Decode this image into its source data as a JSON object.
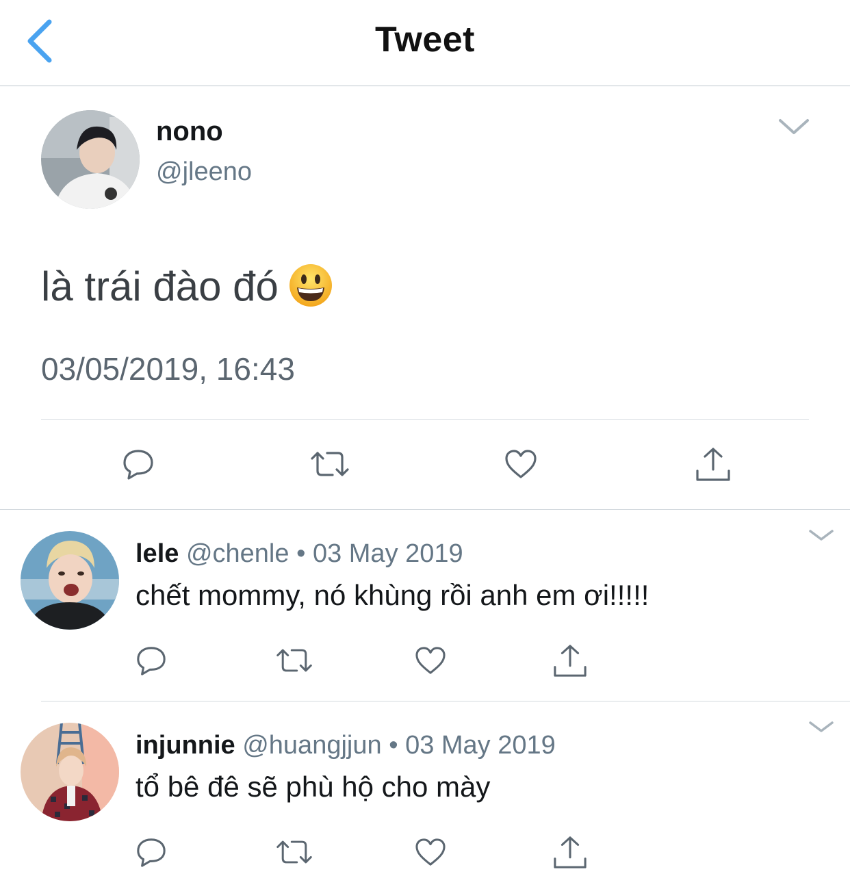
{
  "header": {
    "title": "Tweet"
  },
  "tweet": {
    "name": "nono",
    "handle": "@jleeno",
    "text": "là trái đào đó",
    "emoji": "grinning-face",
    "timestamp": "03/05/2019, 16:43"
  },
  "replies": [
    {
      "name": "lele",
      "handle": "@chenle",
      "date": "03 May 2019",
      "separator": "•",
      "text": "chết mommy, nó khùng rồi anh em ơi!!!!!"
    },
    {
      "name": "injunnie",
      "handle": "@huangjjun",
      "date": "03 May 2019",
      "separator": "•",
      "text": "tổ bê đê sẽ phù hộ cho mày"
    }
  ],
  "icons": [
    "back-chevron-icon",
    "chevron-down-icon",
    "reply-icon",
    "retweet-icon",
    "like-icon",
    "share-icon"
  ],
  "colors": {
    "accent": "#1da1f2",
    "icon": "#657786",
    "text": "#14171a",
    "muted": "#657786"
  }
}
